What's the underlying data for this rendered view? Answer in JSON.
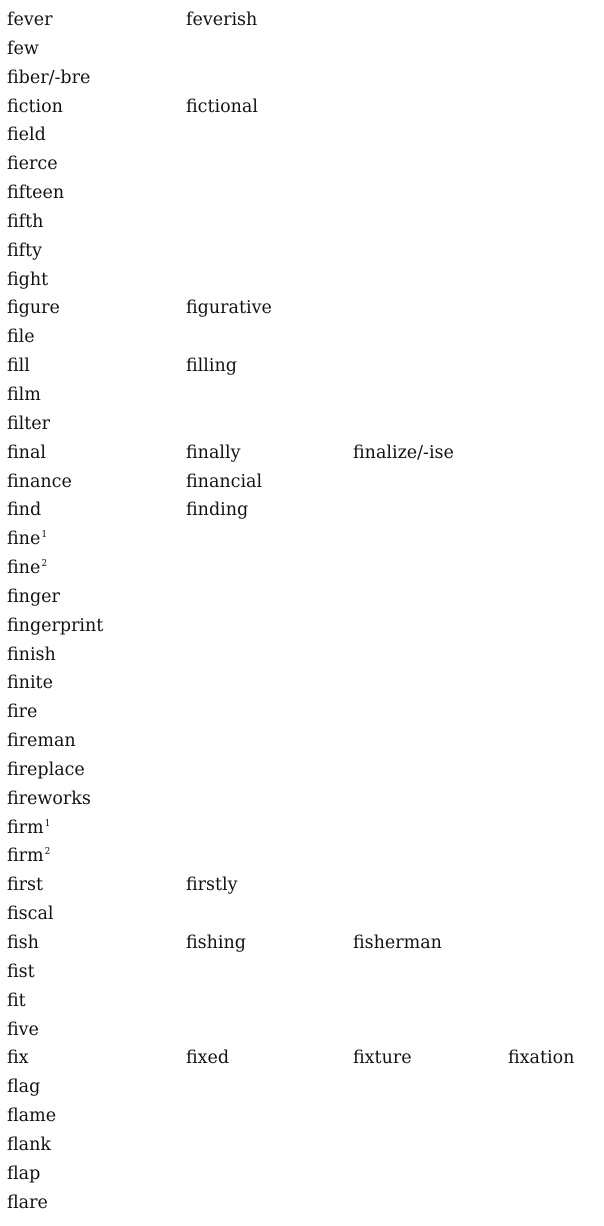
{
  "rows": [
    {
      "words": [
        "fever",
        "feverish"
      ]
    },
    {
      "words": [
        "few"
      ]
    },
    {
      "words": [
        "fiber/-bre"
      ]
    },
    {
      "words": [
        "fiction",
        "fictional"
      ]
    },
    {
      "words": [
        "field"
      ]
    },
    {
      "words": [
        "fierce"
      ]
    },
    {
      "words": [
        "fifteen"
      ]
    },
    {
      "words": [
        "fifth"
      ]
    },
    {
      "words": [
        "fifty"
      ]
    },
    {
      "words": [
        "fight"
      ]
    },
    {
      "words": [
        "figure",
        "figurative"
      ]
    },
    {
      "words": [
        "file"
      ]
    },
    {
      "words": [
        "fill",
        "filling"
      ]
    },
    {
      "words": [
        "film"
      ]
    },
    {
      "words": [
        "filter"
      ]
    },
    {
      "words": [
        "final",
        "finally",
        "finalize/-ise"
      ]
    },
    {
      "words": [
        "finance",
        "financial"
      ]
    },
    {
      "words": [
        "find",
        "finding"
      ]
    },
    {
      "words": [
        "fine"
      ],
      "sup": "1"
    },
    {
      "words": [
        "fine"
      ],
      "sup": "2"
    },
    {
      "words": [
        "finger"
      ]
    },
    {
      "words": [
        "fingerprint"
      ]
    },
    {
      "words": [
        "finish"
      ]
    },
    {
      "words": [
        "finite"
      ]
    },
    {
      "words": [
        "fire"
      ]
    },
    {
      "words": [
        "fireman"
      ]
    },
    {
      "words": [
        "fireplace"
      ]
    },
    {
      "words": [
        "fireworks"
      ]
    },
    {
      "words": [
        "firm"
      ],
      "sup": "1"
    },
    {
      "words": [
        "firm"
      ],
      "sup": "2"
    },
    {
      "words": [
        "first",
        "firstly"
      ]
    },
    {
      "words": [
        "fiscal"
      ]
    },
    {
      "words": [
        "fish",
        "fishing",
        "fisherman"
      ]
    },
    {
      "words": [
        "fist"
      ]
    },
    {
      "words": [
        "fit"
      ]
    },
    {
      "words": [
        "five"
      ]
    },
    {
      "words": [
        "fix",
        "fixed",
        "fixture",
        "fixation"
      ]
    },
    {
      "words": [
        "flag"
      ]
    },
    {
      "words": [
        "flame"
      ]
    },
    {
      "words": [
        "flank"
      ]
    },
    {
      "words": [
        "flap"
      ]
    },
    {
      "words": [
        "flare"
      ]
    }
  ]
}
